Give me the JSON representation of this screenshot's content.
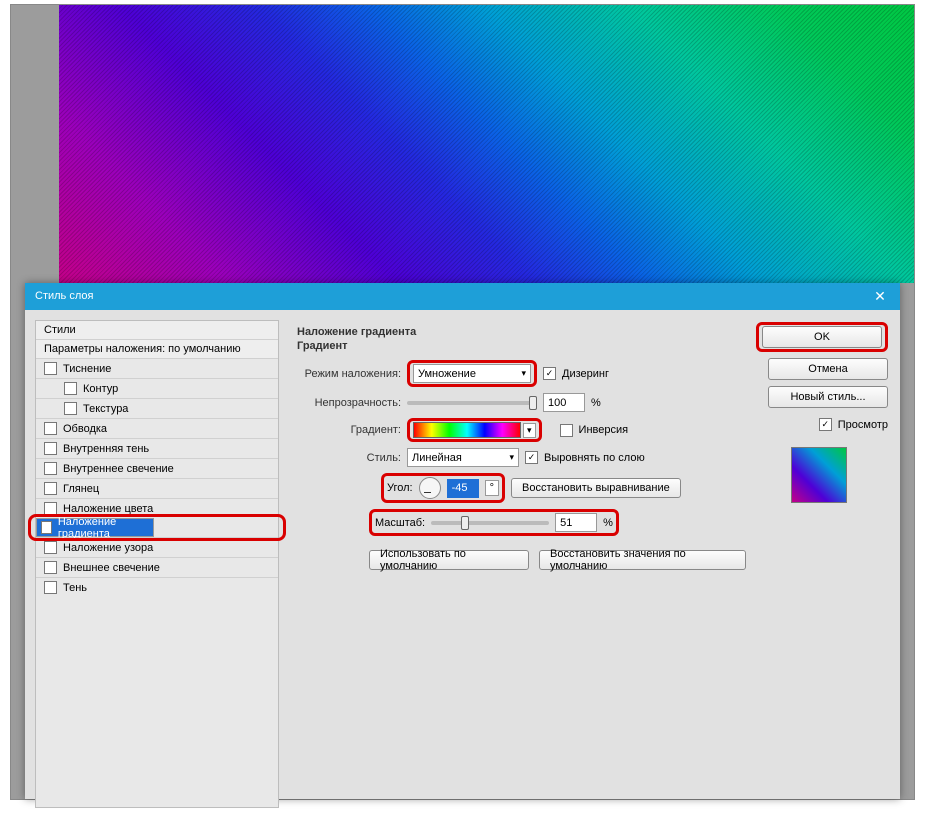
{
  "dialog": {
    "title": "Стиль слоя",
    "close": "✕"
  },
  "left": {
    "styles": "Стили",
    "params": "Параметры наложения: по умолчанию",
    "items": [
      "Тиснение",
      "Контур",
      "Текстура",
      "Обводка",
      "Внутренняя тень",
      "Внутреннее свечение",
      "Глянец",
      "Наложение цвета",
      "Наложение градиента",
      "Наложение узора",
      "Внешнее свечение",
      "Тень"
    ]
  },
  "center": {
    "section_title": "Наложение градиента",
    "section_sub": "Градиент",
    "blend_lbl": "Режим наложения:",
    "blend_val": "Умножение",
    "dither": "Дизеринг",
    "opacity_lbl": "Непрозрачность:",
    "opacity_val": "100",
    "pct": "%",
    "grad_lbl": "Градиент:",
    "invert": "Инверсия",
    "style_lbl": "Стиль:",
    "style_val": "Линейная",
    "align": "Выровнять по слою",
    "angle_lbl": "Угол:",
    "angle_val": "-45",
    "deg": "°",
    "reset_align": "Восстановить выравнивание",
    "scale_lbl": "Масштаб:",
    "scale_val": "51",
    "use_default": "Использовать по умолчанию",
    "reset_default": "Восстановить значения по умолчанию"
  },
  "right": {
    "ok": "OK",
    "cancel": "Отмена",
    "new_style": "Новый стиль...",
    "preview": "Просмотр"
  }
}
